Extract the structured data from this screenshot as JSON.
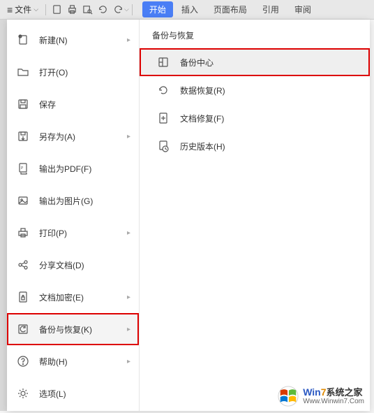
{
  "toolbar": {
    "file_label": "文件",
    "tabs": [
      "开始",
      "插入",
      "页面布局",
      "引用",
      "审阅"
    ]
  },
  "file_menu": [
    {
      "icon": "new",
      "label": "新建(N)",
      "has_submenu": true
    },
    {
      "icon": "open",
      "label": "打开(O)",
      "has_submenu": false
    },
    {
      "icon": "save",
      "label": "保存",
      "has_submenu": false
    },
    {
      "icon": "saveas",
      "label": "另存为(A)",
      "has_submenu": true
    },
    {
      "icon": "pdf",
      "label": "输出为PDF(F)",
      "has_submenu": false
    },
    {
      "icon": "image",
      "label": "输出为图片(G)",
      "has_submenu": false
    },
    {
      "icon": "print",
      "label": "打印(P)",
      "has_submenu": true
    },
    {
      "icon": "share",
      "label": "分享文档(D)",
      "has_submenu": false
    },
    {
      "icon": "encrypt",
      "label": "文档加密(E)",
      "has_submenu": true
    },
    {
      "icon": "backup",
      "label": "备份与恢复(K)",
      "has_submenu": true,
      "highlighted": true
    },
    {
      "icon": "help",
      "label": "帮助(H)",
      "has_submenu": true
    },
    {
      "icon": "options",
      "label": "选项(L)",
      "has_submenu": false
    }
  ],
  "submenu": {
    "title": "备份与恢复",
    "items": [
      {
        "icon": "backup-center",
        "label": "备份中心",
        "highlighted": true
      },
      {
        "icon": "recover",
        "label": "数据恢复(R)"
      },
      {
        "icon": "repair",
        "label": "文档修复(F)"
      },
      {
        "icon": "history",
        "label": "历史版本(H)"
      }
    ]
  },
  "watermark": {
    "brand_w": "Win",
    "brand_7": "7",
    "brand_rest": "系统之家",
    "url": "Www.Winwin7.Com"
  }
}
